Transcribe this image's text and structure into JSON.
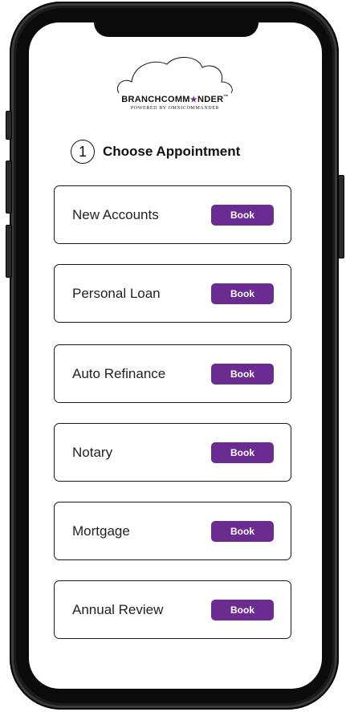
{
  "brand": {
    "name_part1": "BRANCHCOMM",
    "name_star": "★",
    "name_part2": "NDER",
    "trademark": "™",
    "tagline": "POWERED BY OMNICOMMANDER"
  },
  "heading": {
    "step_number": "1",
    "title": "Choose Appointment"
  },
  "appointments": [
    {
      "label": "New Accounts",
      "button": "Book"
    },
    {
      "label": "Personal Loan",
      "button": "Book"
    },
    {
      "label": "Auto Refinance",
      "button": "Book"
    },
    {
      "label": "Notary",
      "button": "Book"
    },
    {
      "label": "Mortgage",
      "button": "Book"
    },
    {
      "label": "Annual Review",
      "button": "Book"
    }
  ],
  "colors": {
    "accent": "#6a2c91",
    "frame": "#1b1b1b",
    "text": "#111111"
  }
}
